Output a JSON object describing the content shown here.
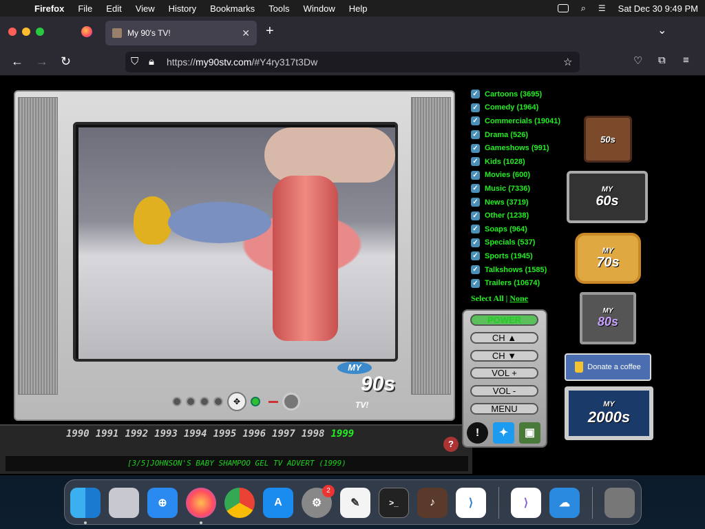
{
  "menubar": {
    "app": "Firefox",
    "items": [
      "File",
      "Edit",
      "View",
      "History",
      "Bookmarks",
      "Tools",
      "Window",
      "Help"
    ],
    "clock": "Sat Dec 30  9:49 PM"
  },
  "browser": {
    "tab_title": "My 90's TV!",
    "url_host": "my90stv.com",
    "url_prefix": "https://",
    "url_rest": "/#Y4ry317t3Dw"
  },
  "categories": [
    {
      "label": "Cartoons (3695)",
      "checked": true
    },
    {
      "label": "Comedy (1964)",
      "checked": true
    },
    {
      "label": "Commercials (19041)",
      "checked": true
    },
    {
      "label": "Drama (526)",
      "checked": true
    },
    {
      "label": "Gameshows (991)",
      "checked": true
    },
    {
      "label": "Kids (1028)",
      "checked": true
    },
    {
      "label": "Movies (600)",
      "checked": true
    },
    {
      "label": "Music (7336)",
      "checked": true
    },
    {
      "label": "News (3719)",
      "checked": true
    },
    {
      "label": "Other (1238)",
      "checked": true
    },
    {
      "label": "Soaps (964)",
      "checked": true
    },
    {
      "label": "Specials (537)",
      "checked": true
    },
    {
      "label": "Sports (1945)",
      "checked": true
    },
    {
      "label": "Talkshows (1585)",
      "checked": true
    },
    {
      "label": "Trailers (10674)",
      "checked": true
    }
  ],
  "select": {
    "all": "Select All",
    "sep": " | ",
    "none": "None"
  },
  "remote": {
    "power": "POWER",
    "ch_up": "CH ▲",
    "ch_down": "CH ▼",
    "vol_up": "VOL +",
    "vol_down": "VOL -",
    "menu": "MENU"
  },
  "years": [
    "1990",
    "1991",
    "1992",
    "1993",
    "1994",
    "1995",
    "1996",
    "1997",
    "1998",
    "1999"
  ],
  "active_year": "1999",
  "caption": "[3/5]JOHNSON'S BABY SHAMPOO GEL TV ADVERT (1999)",
  "tv_logo": {
    "my": "MY",
    "num": "90s",
    "tag": "TV!"
  },
  "decades": [
    "50s",
    "60s",
    "70s",
    "80s",
    "2000s"
  ],
  "decade_my": "MY",
  "decade_tv": "TV!",
  "donate": "Donate a coffee",
  "dock_badge": "2",
  "colors": {
    "accent_green": "#22ee22",
    "remote_blue": "#4a6eb0"
  }
}
